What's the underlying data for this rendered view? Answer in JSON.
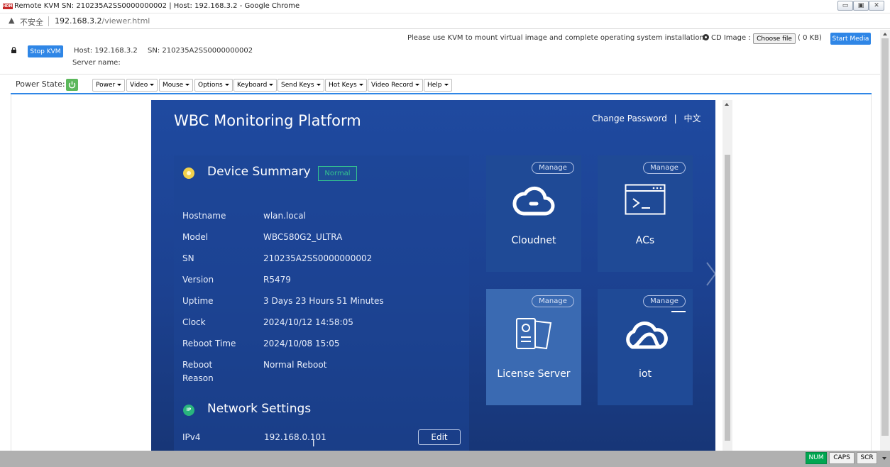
{
  "browser": {
    "title": "Remote KVM SN: 210235A2SS0000000002 | Host: 192.168.3.2 - Google Chrome",
    "insecure_label": "不安全",
    "url_host": "192.168.3.2",
    "url_path": "/viewer.html"
  },
  "kvm": {
    "stop_label": "Stop KVM",
    "host_text": "Host: 192.168.3.2",
    "sn_text": "SN: 210235A2SS0000000002",
    "server_name_text": "Server name:",
    "notice": "Please use KVM to mount virtual image and complete operating system installation.",
    "cd_image_label": "CD Image :",
    "choose_file_label": "Choose file",
    "file_size": "( 0 KB)",
    "start_media_label": "Start Media"
  },
  "menubar": {
    "power_state_label": "Power State:",
    "menus": [
      "Power",
      "Video",
      "Mouse",
      "Options",
      "Keyboard",
      "Send Keys",
      "Hot Keys",
      "Video Record",
      "Help"
    ]
  },
  "remote": {
    "platform_title": "WBC Monitoring Platform",
    "change_password": "Change Password",
    "lang_sep": "|",
    "lang_switch": "中文",
    "device_summary": {
      "title": "Device Summary",
      "status": "Normal",
      "rows": [
        {
          "key": "Hostname",
          "value": "wlan.local"
        },
        {
          "key": "Model",
          "value": "WBC580G2_ULTRA"
        },
        {
          "key": "SN",
          "value": "210235A2SS0000000002"
        },
        {
          "key": "Version",
          "value": "R5479"
        },
        {
          "key": "Uptime",
          "value": "3 Days 23 Hours 51 Minutes"
        },
        {
          "key": "Clock",
          "value": "2024/10/12 14:58:05"
        },
        {
          "key": "Reboot Time",
          "value": "2024/10/08 15:05"
        },
        {
          "key": "Reboot\nReason",
          "value": "Normal Reboot"
        }
      ]
    },
    "network_settings": {
      "title": "Network Settings",
      "icon_text": "IP",
      "ipv4_label": "IPv4",
      "ipv4_value": "192.168.0.101",
      "edit_label": "Edit"
    },
    "tiles": [
      {
        "label": "Cloudnet",
        "manage": "Manage",
        "icon": "cloud-link-icon"
      },
      {
        "label": "ACs",
        "manage": "Manage",
        "icon": "terminal-window-icon"
      },
      {
        "label": "License Server",
        "manage": "Manage",
        "icon": "license-document-icon"
      },
      {
        "label": "iot",
        "manage": "Manage",
        "icon": "iot-cloud-icon"
      }
    ]
  },
  "status_indicators": {
    "num": "NUM",
    "caps": "CAPS",
    "scr": "SCR"
  },
  "colors": {
    "accent_blue": "#2f86e6",
    "normal_green": "#34c38f",
    "power_green": "#5cb85c",
    "num_green": "#00a651"
  }
}
